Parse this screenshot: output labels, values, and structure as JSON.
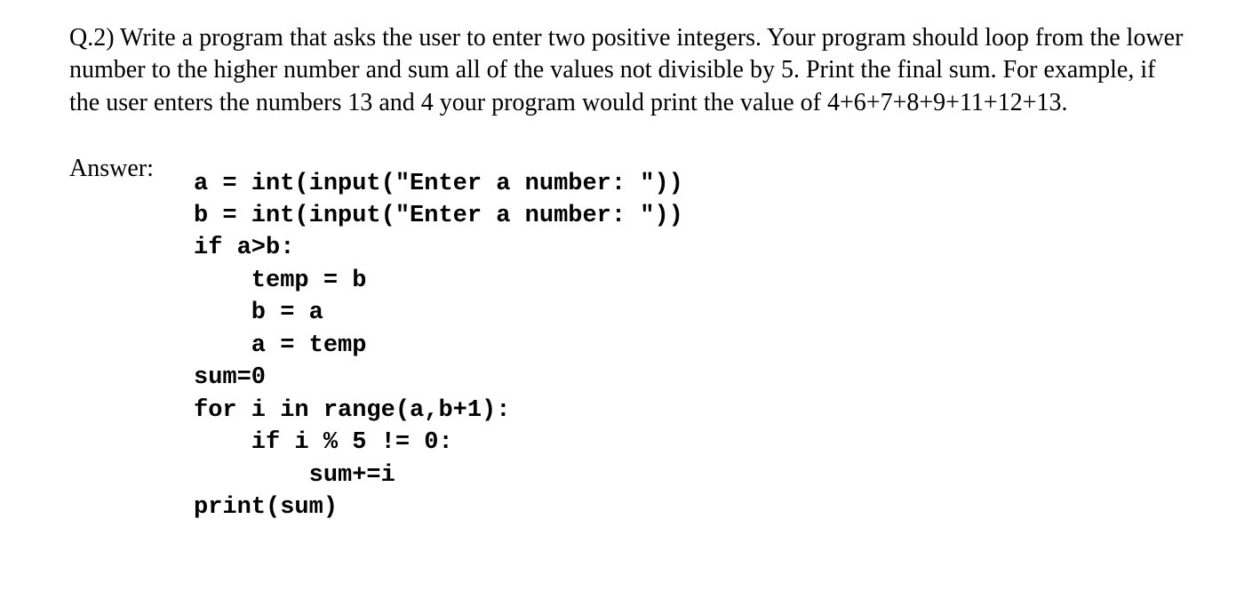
{
  "question": {
    "text": "Q.2) Write a program that asks the user to enter two positive integers. Your program should loop from the lower number to the higher number and sum all of the values not divisible by 5. Print the final sum. For example, if the user enters the numbers 13 and 4 your program would print the value of  4+6+7+8+9+11+12+13."
  },
  "answer": {
    "label": "Answer:",
    "code": "a = int(input(\"Enter a number: \"))\nb = int(input(\"Enter a number: \"))\nif a>b:\n    temp = b\n    b = a\n    a = temp\nsum=0\nfor i in range(a,b+1):\n    if i % 5 != 0:\n        sum+=i\nprint(sum)"
  }
}
